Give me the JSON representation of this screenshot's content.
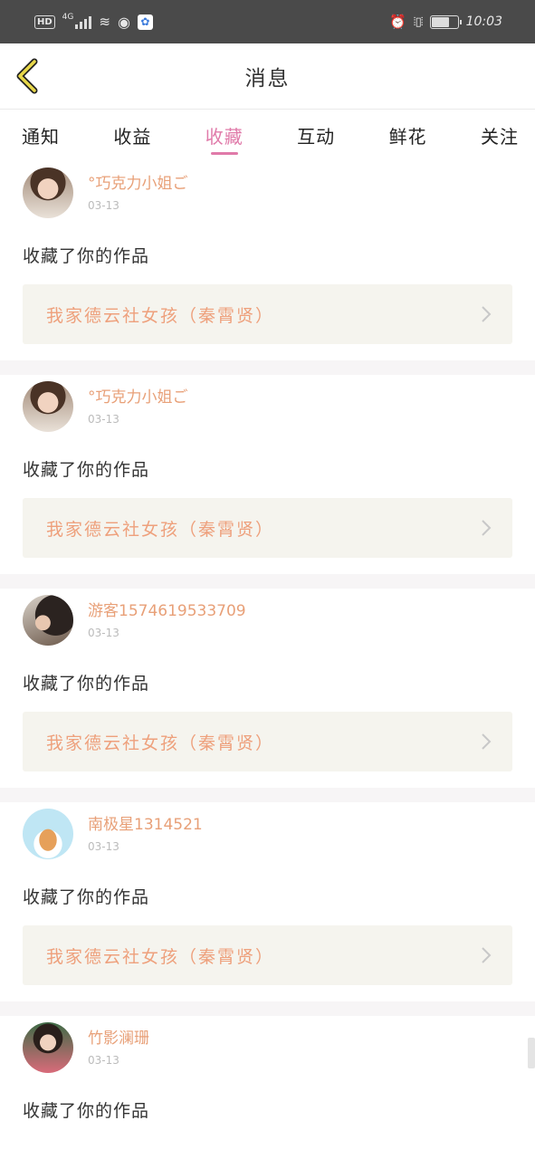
{
  "status_bar": {
    "hd": "HD",
    "network": "4G",
    "time": "10:03",
    "icons": [
      "signal-icon",
      "wifi-icon",
      "eye-icon",
      "baidu-paw-icon",
      "alarm-icon",
      "vibrate-icon",
      "battery-icon"
    ]
  },
  "header": {
    "title": "消息",
    "back_icon": "chevron-left-icon"
  },
  "tabs": [
    {
      "label": "通知"
    },
    {
      "label": "收益"
    },
    {
      "label": "收藏",
      "active": true
    },
    {
      "label": "互动"
    },
    {
      "label": "鲜花"
    },
    {
      "label": "关注"
    }
  ],
  "feed": [
    {
      "user": "°巧克力小姐ご",
      "date": "03-13",
      "action": "收藏了你的作品",
      "work": "我家德云社女孩（秦霄贤）"
    },
    {
      "user": "°巧克力小姐ご",
      "date": "03-13",
      "action": "收藏了你的作品",
      "work": "我家德云社女孩（秦霄贤）"
    },
    {
      "user": "游客1574619533709",
      "date": "03-13",
      "action": "收藏了你的作品",
      "work": "我家德云社女孩（秦霄贤）"
    },
    {
      "user": "南极星1314521",
      "date": "03-13",
      "action": "收藏了你的作品",
      "work": "我家德云社女孩（秦霄贤）"
    },
    {
      "user": "竹影澜珊",
      "date": "03-13",
      "action": "收藏了你的作品",
      "work": ""
    }
  ],
  "colors": {
    "accent": "#e07aa9",
    "username": "#e8a078",
    "work_title": "#eea07c",
    "work_box": "#f5f4ee",
    "status_bar": "#4a4a4a",
    "back_icon_stroke": "#e8d84a"
  }
}
